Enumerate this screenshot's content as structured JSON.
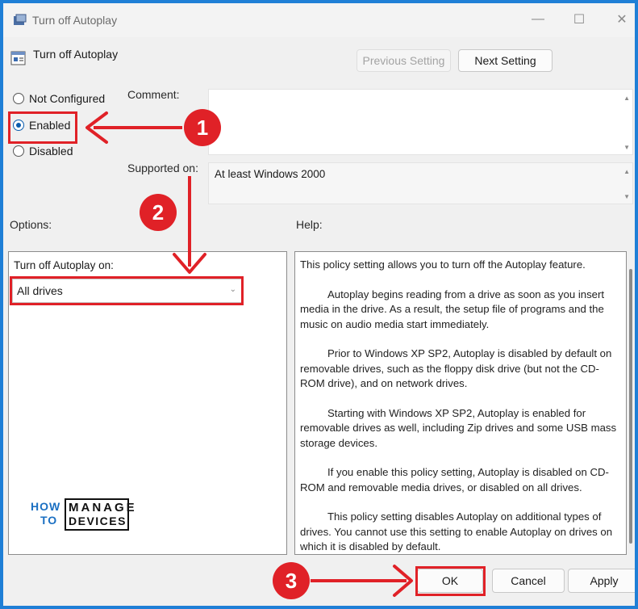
{
  "window": {
    "title": "Turn off Autoplay",
    "controls": {
      "minimize": "—",
      "maximize": "☐",
      "close": "✕"
    }
  },
  "header": {
    "policy_name": "Turn off Autoplay",
    "previous_setting": "Previous Setting",
    "next_setting": "Next Setting"
  },
  "state": {
    "options": [
      "Not Configured",
      "Enabled",
      "Disabled"
    ],
    "selected": "Enabled"
  },
  "comment": {
    "label": "Comment:",
    "value": ""
  },
  "supported": {
    "label": "Supported on:",
    "value": "At least Windows 2000"
  },
  "options_section": {
    "label": "Options:",
    "field_label": "Turn off Autoplay on:",
    "dropdown_value": "All drives"
  },
  "help_section": {
    "label": "Help:",
    "paragraphs": [
      "This policy setting allows you to turn off the Autoplay feature.",
      "Autoplay begins reading from a drive as soon as you insert media in the drive. As a result, the setup file of programs and the music on audio media start immediately.",
      "Prior to Windows XP SP2, Autoplay is disabled by default on removable drives, such as the floppy disk drive (but not the CD-ROM drive), and on network drives.",
      "Starting with Windows XP SP2, Autoplay is enabled for removable drives as well, including Zip drives and some USB mass storage devices.",
      "If you enable this policy setting, Autoplay is disabled on CD-ROM and removable media drives, or disabled on all drives.",
      "This policy setting disables Autoplay on additional types of drives. You cannot use this setting to enable Autoplay on drives on which it is disabled by default."
    ]
  },
  "footer": {
    "ok": "OK",
    "cancel": "Cancel",
    "apply": "Apply"
  },
  "annotations": {
    "step1": "1",
    "step2": "2",
    "step3": "3"
  },
  "logo": {
    "how": "HOW",
    "to": "TO",
    "manage": "MANAGE",
    "devices": "DEVICES"
  },
  "colors": {
    "accent_red": "#e02127",
    "frame_blue": "#1f7fd6",
    "radio_blue": "#0b5cad"
  }
}
